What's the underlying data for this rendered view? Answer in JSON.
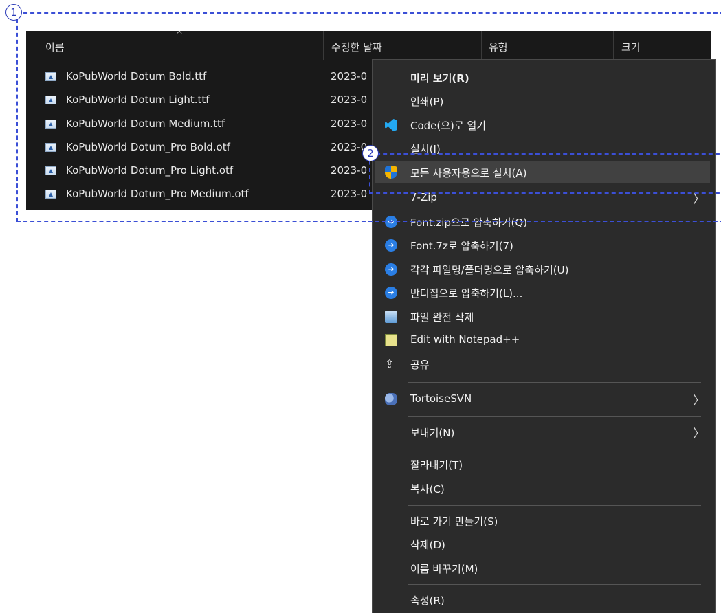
{
  "annotations": {
    "marker_1": "1",
    "marker_2": "2"
  },
  "explorer": {
    "columns": {
      "name": "이름",
      "modified": "수정한 날짜",
      "type": "유형",
      "size": "크기"
    },
    "sort_indicator": "^",
    "files": [
      {
        "name": "KoPubWorld Dotum Bold.ttf",
        "date": "2023-0"
      },
      {
        "name": "KoPubWorld Dotum Light.ttf",
        "date": "2023-0"
      },
      {
        "name": "KoPubWorld Dotum Medium.ttf",
        "date": "2023-0"
      },
      {
        "name": "KoPubWorld Dotum_Pro Bold.otf",
        "date": "2023-0"
      },
      {
        "name": "KoPubWorld Dotum_Pro Light.otf",
        "date": "2023-0"
      },
      {
        "name": "KoPubWorld Dotum_Pro Medium.otf",
        "date": "2023-0"
      }
    ]
  },
  "context_menu": {
    "preview": "미리 보기(R)",
    "print": "인쇄(P)",
    "open_code": "Code(으)로 열기",
    "install": "설치(I)",
    "install_all_users": "모든 사용자용으로 설치(A)",
    "zip7": "7-Zip",
    "zip_font": "Font.zip으로 압축하기(Q)",
    "sevenz_font": "Font.7z로 압축하기(7)",
    "each_compress": "각각 파일명/폴더명으로 압축하기(U)",
    "bandizip": "반디집으로 압축하기(L)...",
    "shred": "파일 완전 삭제",
    "notepadpp": "Edit with Notepad++",
    "share": "공유",
    "tortoise": "TortoiseSVN",
    "send_to": "보내기(N)",
    "cut": "잘라내기(T)",
    "copy": "복사(C)",
    "shortcut": "바로 가기 만들기(S)",
    "delete": "삭제(D)",
    "rename": "이름 바꾸기(M)",
    "properties": "속성(R)",
    "submenu_arrow": "〉",
    "icons": {
      "code": "vscode-icon",
      "install_all_users": "uac-shield-icon",
      "bandizip": "bandizip-icon",
      "shred": "shredder-icon",
      "notepadpp": "notepad-plus-plus-icon",
      "share": "share-icon",
      "tortoise": "tortoisesvn-icon"
    }
  }
}
